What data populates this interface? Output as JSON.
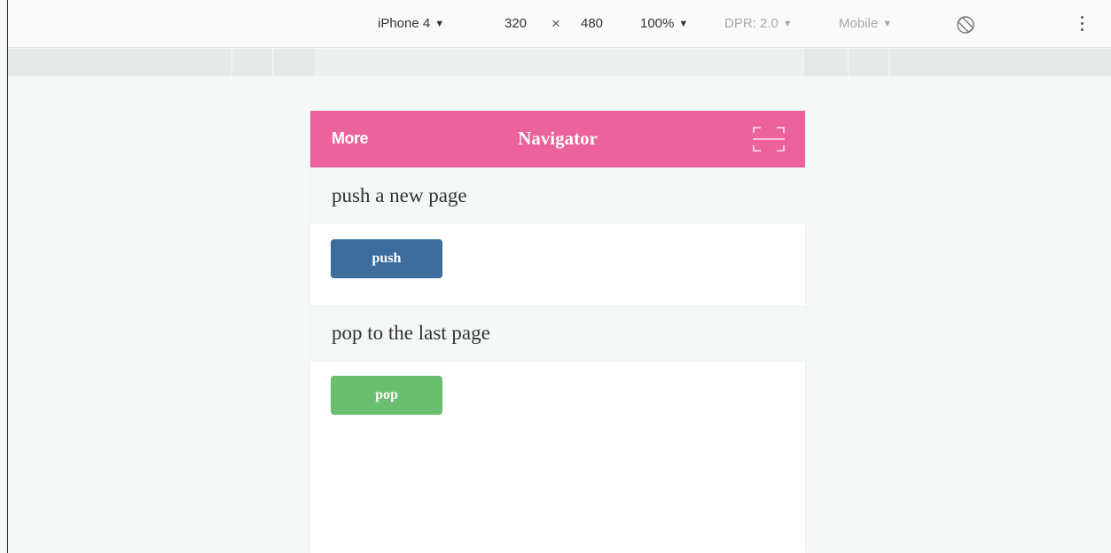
{
  "toolbar": {
    "device": "iPhone 4",
    "width": "320",
    "times": "×",
    "height": "480",
    "zoom": "100%",
    "dpr": "DPR: 2.0",
    "mode": "Mobile",
    "dropdown_glyph": "▼"
  },
  "navbar": {
    "left_label": "More",
    "title": "Navigator",
    "right_icon": "scan-icon",
    "color": "#ec629b"
  },
  "sections": [
    {
      "heading": "push a new page",
      "button_label": "push",
      "button_color": "#3b6c9c"
    },
    {
      "heading": "pop to the last page",
      "button_label": "pop",
      "button_color": "#69bf6f"
    }
  ]
}
